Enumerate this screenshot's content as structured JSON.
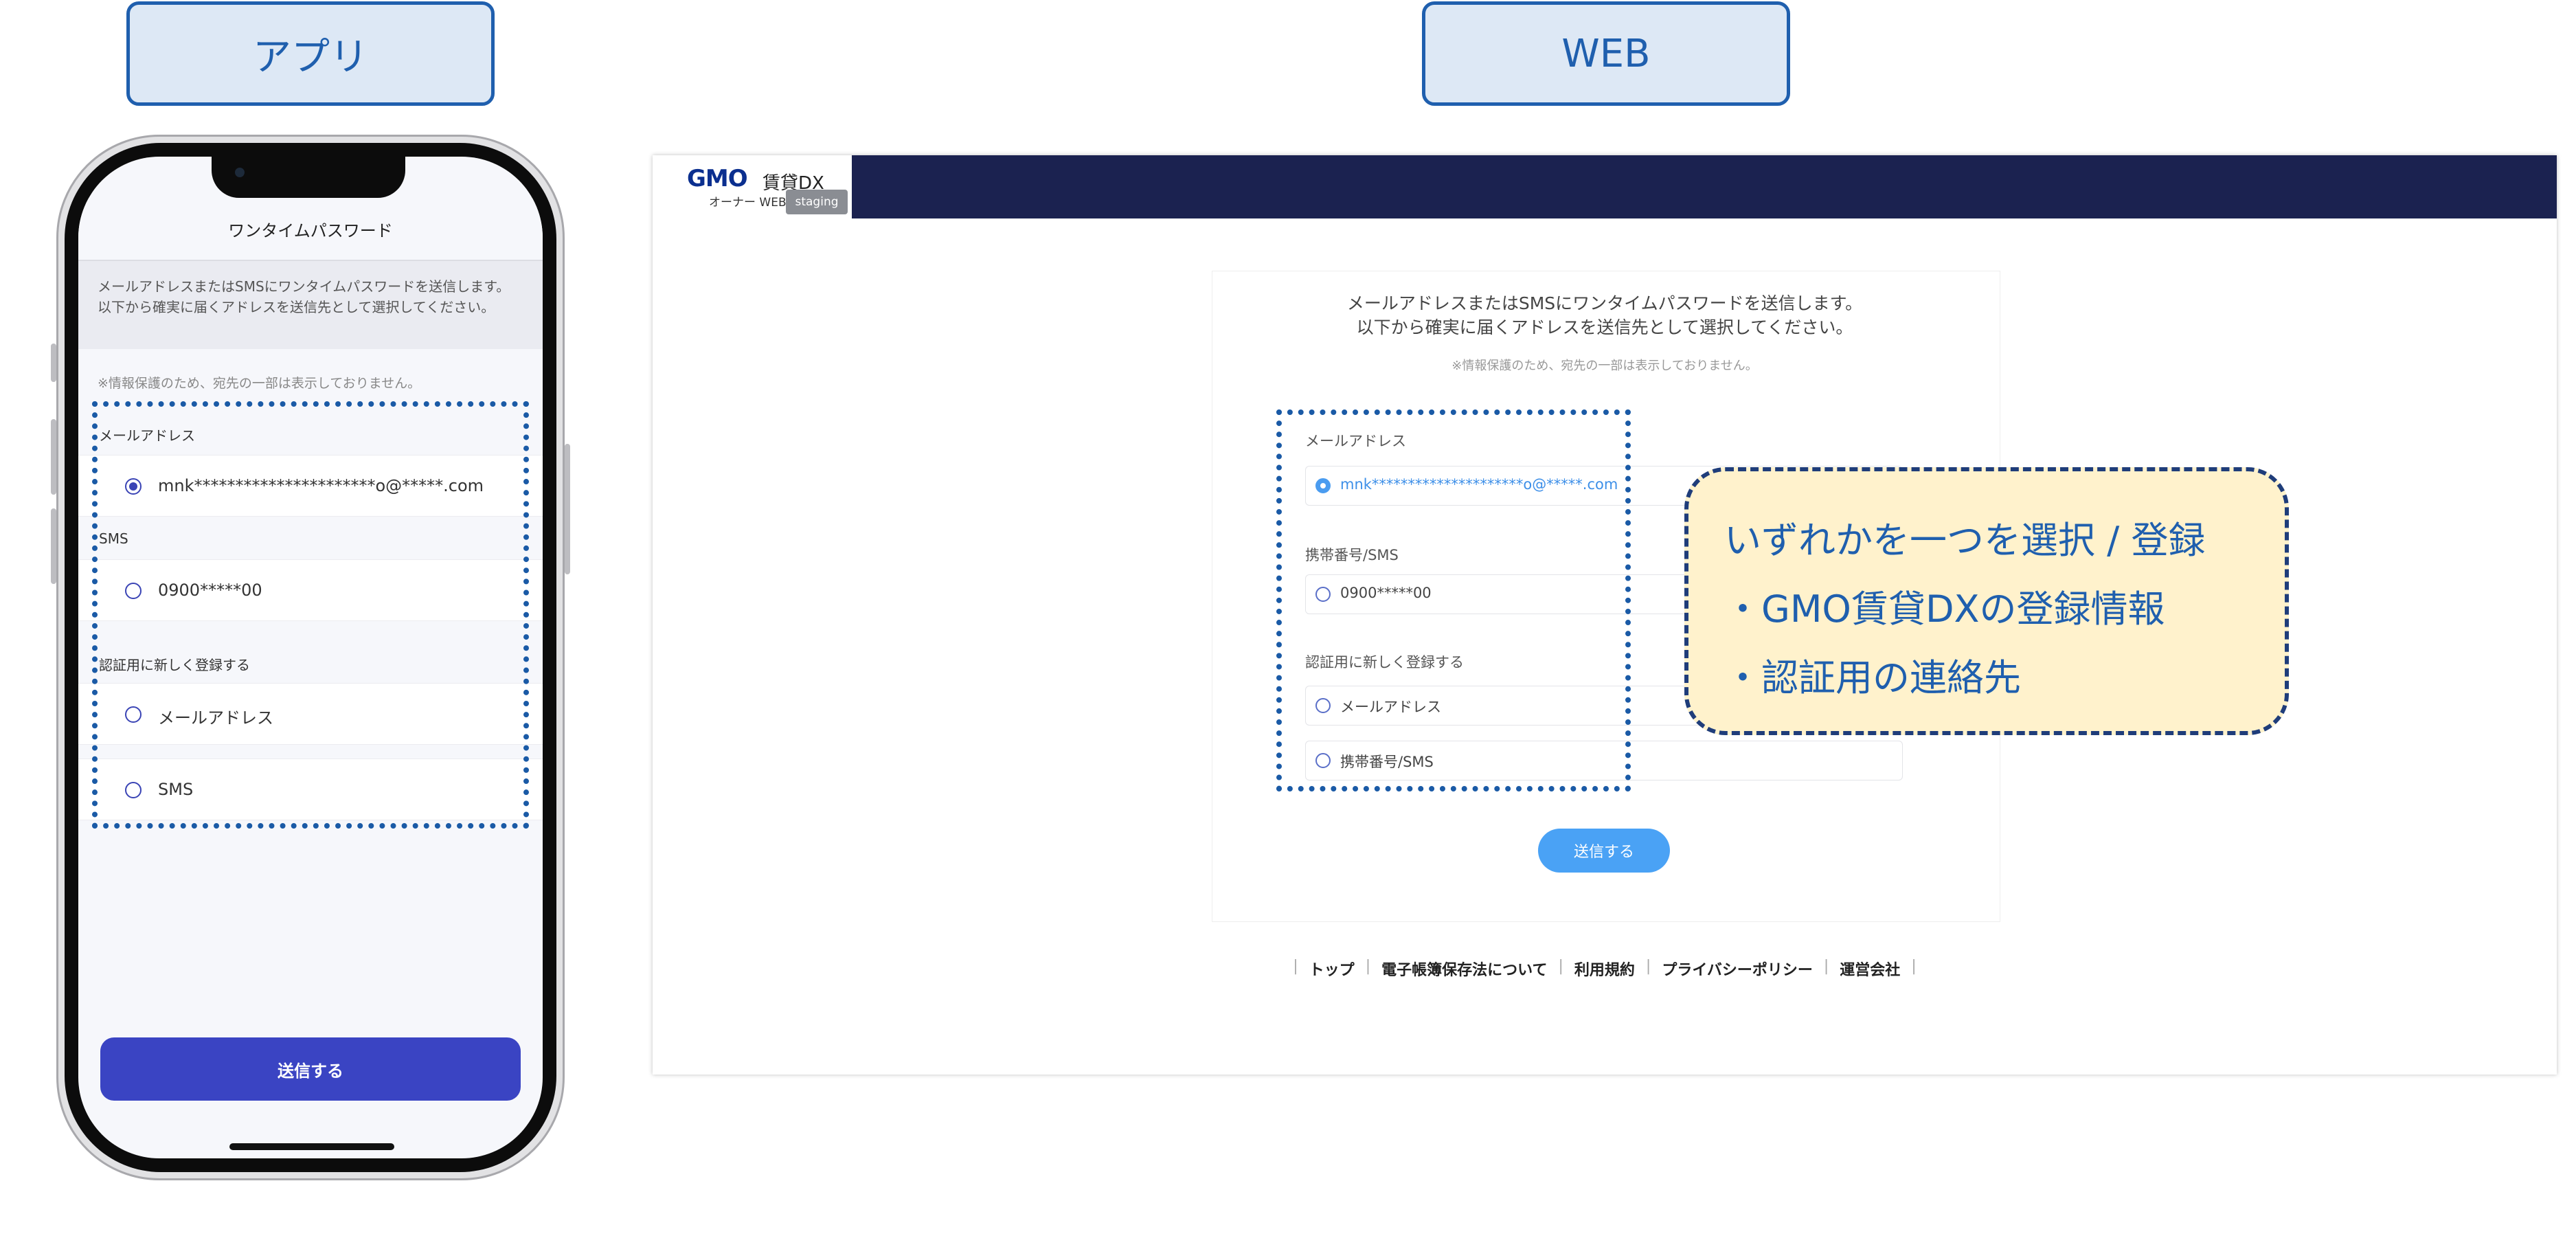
{
  "section_labels": {
    "app": "アプリ",
    "web": "WEB"
  },
  "app": {
    "title": "ワンタイムパスワード",
    "description": "メールアドレスまたはSMSにワンタイムパスワードを送信します。以下から確実に届くアドレスを送信先として選択してください。",
    "note": "※情報保護のため、宛先の一部は表示しておりません。",
    "groups": {
      "email_label": "メールアドレス",
      "sms_label": "SMS",
      "new_label": "認証用に新しく登録する"
    },
    "options": {
      "email": "mnk**********************o@*****.com",
      "sms": "0900*****00",
      "new_email": "メールアドレス",
      "new_sms": "SMS"
    },
    "submit_label": "送信する"
  },
  "web": {
    "logo_brand": "GMO",
    "logo_product": "賃貸DX",
    "logo_sub": "オーナー WEB",
    "staging_badge": "staging",
    "description_line1": "メールアドレスまたはSMSにワンタイムパスワードを送信します。",
    "description_line2": "以下から確実に届くアドレスを送信先として選択してください。",
    "note": "※情報保護のため、宛先の一部は表示しておりません。",
    "groups": {
      "email_label": "メールアドレス",
      "sms_label": "携帯番号/SMS",
      "new_label": "認証用に新しく登録する"
    },
    "options": {
      "email": "mnk*********************o@*****.com",
      "sms": "0900*****00",
      "new_email": "メールアドレス",
      "new_sms": "携帯番号/SMS"
    },
    "submit_label": "送信する",
    "footer": [
      "トップ",
      "電子帳簿保存法について",
      "利用規約",
      "プライバシーポリシー",
      "運営会社"
    ]
  },
  "callout": {
    "line1": "いずれかを一つを選択 / 登録",
    "line2": "・GMO賃貸DXの登録情報",
    "line3": "・認証用の連絡先"
  },
  "colors": {
    "accent_blue": "#1f5fae",
    "app_button": "#3a44c3",
    "web_header": "#1b2250",
    "web_button": "#4aa2f5",
    "callout_bg": "#fff2cc"
  }
}
